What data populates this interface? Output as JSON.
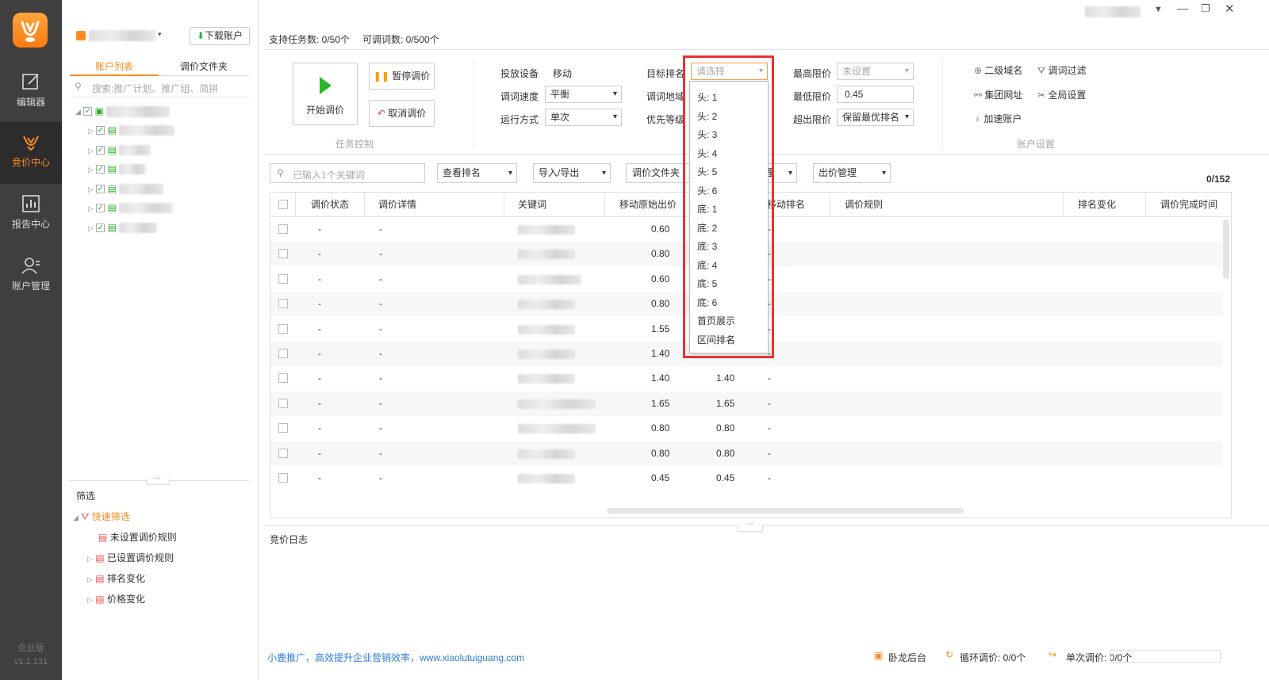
{
  "nav": {
    "items": [
      {
        "label": "编辑器",
        "icon": "edit-icon"
      },
      {
        "label": "竞价中心",
        "icon": "deer-icon"
      },
      {
        "label": "报告中心",
        "icon": "chart-icon"
      },
      {
        "label": "账户管理",
        "icon": "user-icon"
      }
    ],
    "edition": "企业版",
    "version": "v1.1.131"
  },
  "left_panel": {
    "download_btn": "下载账户",
    "tabs": [
      "账户列表",
      "调价文件夹"
    ],
    "search_placeholder": "搜索:推广计划、推广组、简拼",
    "filter_title": "筛选",
    "quick_filter": "快速筛选",
    "filters": [
      "未设置调价规则",
      "已设置调价规则",
      "排名变化",
      "价格变化"
    ]
  },
  "header": {
    "task_count": "支持任务数: 0/50个",
    "adjust_count": "可调词数: 0/500个"
  },
  "task_control": {
    "start": "开始调价",
    "pause": "暂停调价",
    "cancel": "取消调价",
    "group_label": "任务控制"
  },
  "settings": {
    "device_label": "投放设备",
    "device_value": "移动",
    "speed_label": "调词速度",
    "speed_value": "平衡",
    "mode_label": "运行方式",
    "mode_value": "单次",
    "target_label": "目标排名",
    "target_placeholder": "请选择",
    "region_label": "调词地域",
    "priority_label": "优先等级",
    "max_label": "最高限价",
    "max_placeholder": "未设置",
    "min_label": "最低限价",
    "min_value": "0.45",
    "over_label": "超出限价",
    "over_value": "保留最优排名"
  },
  "account_settings": {
    "items": [
      "二级域名",
      "调词过滤",
      "集团网址",
      "全局设置",
      "加速账户"
    ],
    "group_label": "账户设置"
  },
  "toolbar": {
    "search_placeholder": "已输入1个关键词",
    "view_rank": "查看排名",
    "import_export": "导入/导出",
    "folder": "调价文件夹",
    "hidden_tail": "理",
    "bid_manage": "出价管理",
    "count": "0/152"
  },
  "table": {
    "headers": [
      "调价状态",
      "调价详情",
      "关键词",
      "移动原始出价",
      "移动排名",
      "调价规则",
      "排名变化",
      "调价完成时间"
    ],
    "rows": [
      {
        "status": "-",
        "detail": "-",
        "orig": "0.60",
        "cur": "",
        "rank": "-"
      },
      {
        "status": "-",
        "detail": "-",
        "orig": "0.80",
        "cur": "",
        "rank": "-"
      },
      {
        "status": "-",
        "detail": "-",
        "orig": "0.60",
        "cur": "",
        "rank": "-"
      },
      {
        "status": "-",
        "detail": "-",
        "orig": "0.80",
        "cur": "",
        "rank": "-"
      },
      {
        "status": "-",
        "detail": "-",
        "orig": "1.55",
        "cur": "",
        "rank": "-"
      },
      {
        "status": "-",
        "detail": "-",
        "orig": "1.40",
        "cur": "",
        "rank": "-"
      },
      {
        "status": "-",
        "detail": "-",
        "orig": "1.40",
        "cur": "1.40",
        "rank": "-"
      },
      {
        "status": "-",
        "detail": "-",
        "orig": "1.65",
        "cur": "1.65",
        "rank": "-"
      },
      {
        "status": "-",
        "detail": "-",
        "orig": "0.80",
        "cur": "0.80",
        "rank": "-"
      },
      {
        "status": "-",
        "detail": "-",
        "orig": "0.80",
        "cur": "0.80",
        "rank": "-"
      },
      {
        "status": "-",
        "detail": "-",
        "orig": "0.45",
        "cur": "0.45",
        "rank": "-"
      }
    ]
  },
  "dropdown": {
    "options": [
      "头: 1",
      "头: 2",
      "头: 3",
      "头: 4",
      "头: 5",
      "头: 6",
      "底: 1",
      "底: 2",
      "底: 3",
      "底: 4",
      "底: 5",
      "底: 6",
      "首页展示",
      "区间排名"
    ]
  },
  "log": {
    "title": "竞价日志"
  },
  "footer": {
    "slogan": "小鹿推广，高效提升企业营销效率，www.xiaolutuiguang.com",
    "backend": "卧龙后台",
    "loop": "循环调价: 0/0个",
    "single": "单次调价: 0/0个"
  },
  "colors": {
    "accent": "#ff8a1e",
    "nav_bg": "#3f3f3f",
    "highlight": "#e8332f"
  }
}
